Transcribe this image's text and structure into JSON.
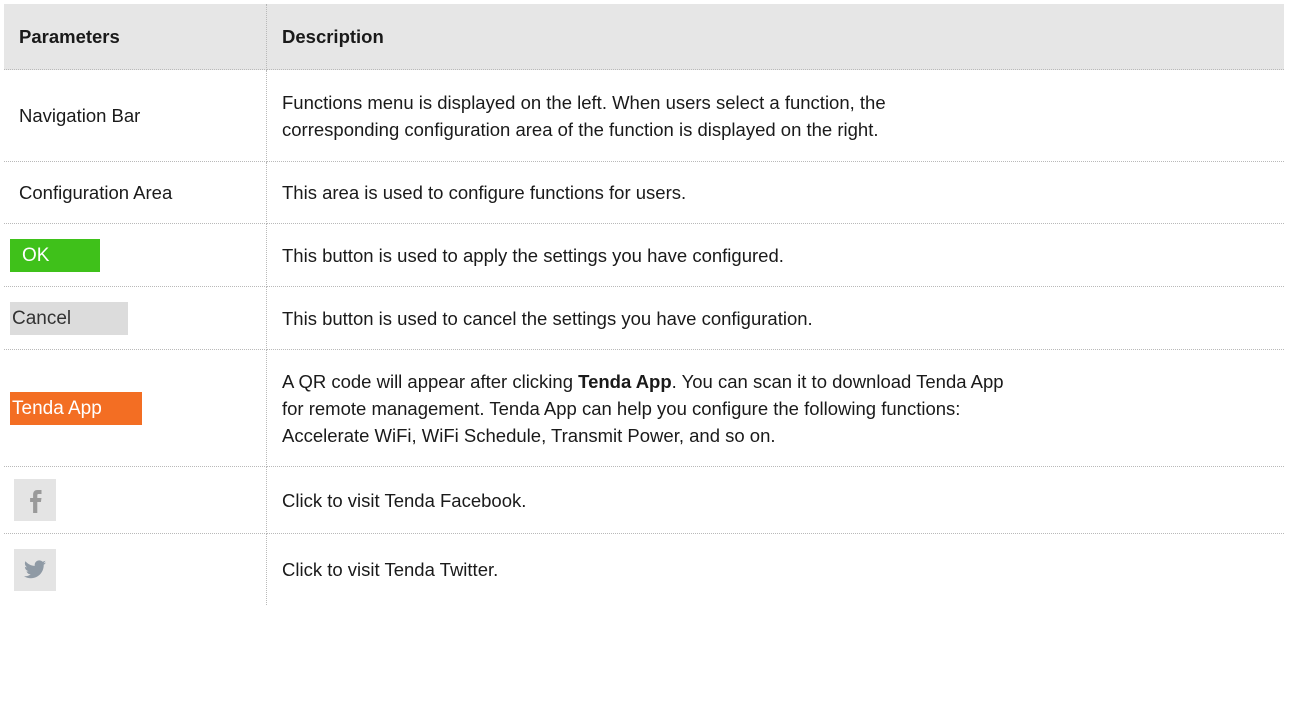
{
  "table": {
    "headers": {
      "parameters": "Parameters",
      "description": "Description"
    },
    "rows": [
      {
        "parameter": "Navigation Bar",
        "description_line1": "Functions menu is displayed on the left. When users select a function, the",
        "description_line2": "corresponding configuration area of the function is displayed on the right."
      },
      {
        "parameter": "Configuration Area",
        "description": "This area is used to configure functions for users."
      },
      {
        "button_label": "OK",
        "description": "This button is used to apply the settings you have configured."
      },
      {
        "button_label": "Cancel",
        "description": "This button is used to cancel the settings you have configuration."
      },
      {
        "button_label": "Tenda App",
        "description_pre": "A QR code will appear after clicking ",
        "description_bold": "Tenda App",
        "description_post": ". You can scan it to download Tenda App",
        "description_line2": "for remote management. Tenda App can help you configure the following functions:",
        "description_line3": "Accelerate WiFi, WiFi Schedule, Transmit Power, and so on."
      },
      {
        "icon": "facebook-icon",
        "description": "Click to visit Tenda Facebook."
      },
      {
        "icon": "twitter-icon",
        "description": "Click to visit Tenda Twitter."
      }
    ]
  },
  "colors": {
    "ok_button": "#3fc11a",
    "cancel_button": "#dcdcdc",
    "tenda_button": "#f36e23",
    "header_bg": "#e6e6e6",
    "icon_bg": "#e4e4e4"
  }
}
